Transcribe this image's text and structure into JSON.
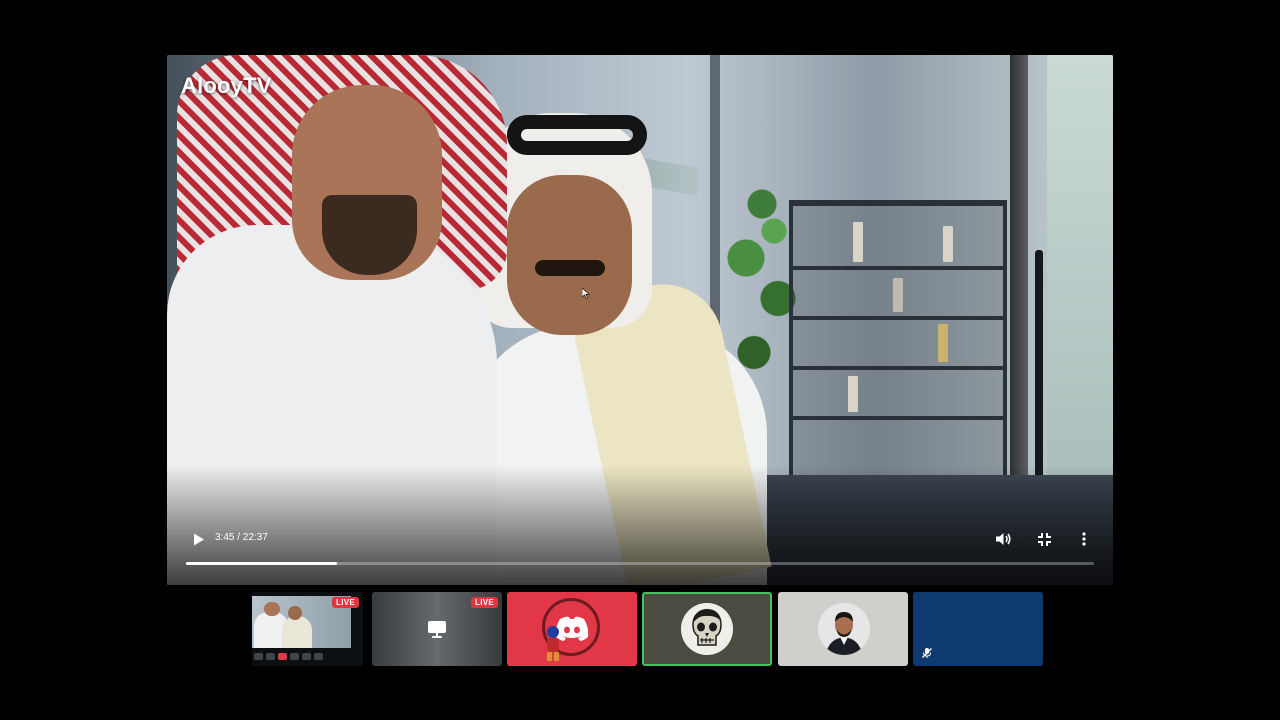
{
  "video": {
    "brand": "AlooyTV",
    "time": "3:45 / 22:37",
    "progress": 0.166,
    "controls": {
      "play_icon": "play-icon",
      "volume_icon": "volume-icon",
      "fullscreen_exit_icon": "fullscreen-exit-icon",
      "more_icon": "more-vertical-icon"
    }
  },
  "participants": [
    {
      "type": "stream",
      "badge": "LIVE"
    },
    {
      "type": "screen-share",
      "badge": "LIVE",
      "icon": "monitor-icon"
    },
    {
      "type": "avatar",
      "icon": "discord-icon",
      "color": "#e23747"
    },
    {
      "type": "avatar",
      "icon": "skull-avatar",
      "speaking": true,
      "color": "#4c4b42",
      "highlight": "#46c25a"
    },
    {
      "type": "avatar",
      "icon": "man-avatar",
      "color": "#cfcfcc"
    },
    {
      "type": "muted",
      "icon": "mic-off-icon",
      "color": "#0f3a6f"
    }
  ],
  "colors": {
    "background": "#000000",
    "progress_fill": "#ffffff",
    "live_badge": "#e1343c"
  }
}
